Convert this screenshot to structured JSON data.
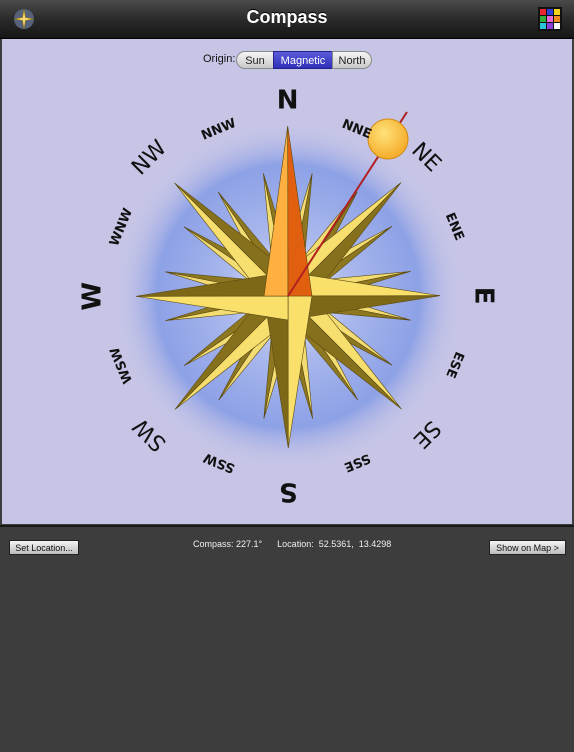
{
  "header": {
    "title": "Compass",
    "app_icon": "compass-rose-icon",
    "grid_icon": "color-grid-icon",
    "grid_colors": [
      "#e8262f",
      "#2f3fd8",
      "#f2d41f",
      "#2fae3a",
      "#e86ad8",
      "#f28a1f",
      "#28c6d8",
      "#8a3fd8",
      "#f8f8f8"
    ]
  },
  "origin": {
    "label": "Origin:",
    "options": [
      "Sun",
      "Magnetic",
      "North"
    ],
    "selected": "Magnetic"
  },
  "compass": {
    "points_major": [
      "N",
      "E",
      "S",
      "W"
    ],
    "points_ordinal": [
      "NE",
      "SE",
      "SW",
      "NW"
    ],
    "points_16": [
      "NNE",
      "ENE",
      "ESE",
      "SSE",
      "SSW",
      "WSW",
      "WNW",
      "NNW"
    ],
    "heading_degrees": 227.1,
    "needle_color": "#e06010",
    "sun_color": "#f5b030",
    "sun_line_color": "#b02020"
  },
  "status": {
    "compass_label": "Compass:",
    "compass_value": "227.1°",
    "location_label": "Location:",
    "location_value": "52.5361,  13.4298"
  },
  "buttons": {
    "set_location": "Set Location...",
    "show_on_map": "Show on Map >"
  }
}
